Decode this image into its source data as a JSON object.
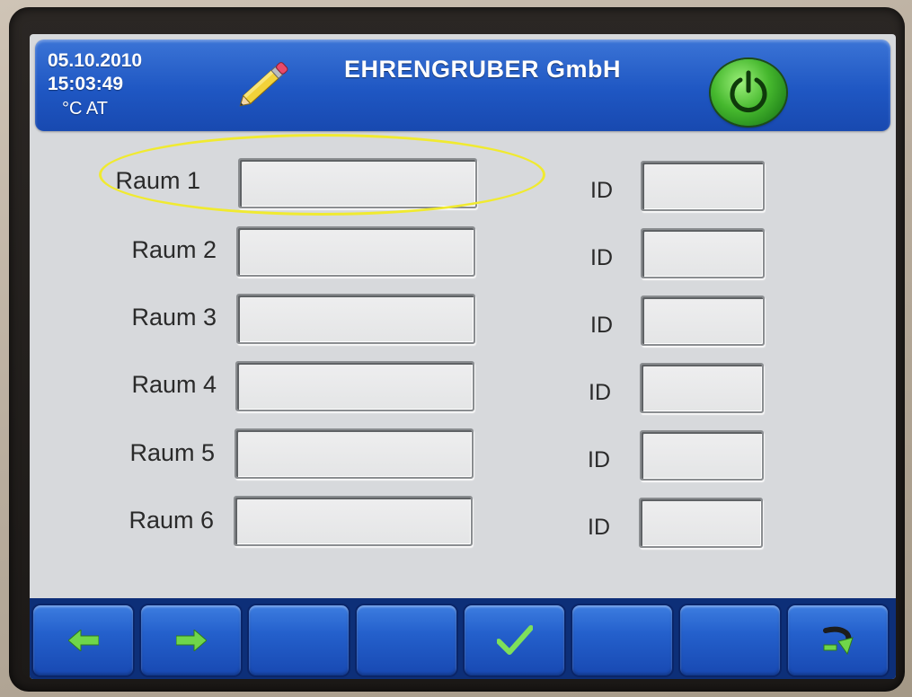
{
  "header": {
    "date": "05.10.2010",
    "time": "15:03:49",
    "unit_country": "°C AT",
    "company": "EHRENGRUBER GmbH",
    "edit_icon": "pencil-icon",
    "power_icon": "power-icon",
    "colors": {
      "accent": "#1f57c3",
      "power": "#46b82e"
    }
  },
  "rooms": [
    {
      "label": "Raum 1",
      "name_value": "",
      "id_label": "ID",
      "id_value": ""
    },
    {
      "label": "Raum 2",
      "name_value": "",
      "id_label": "ID",
      "id_value": ""
    },
    {
      "label": "Raum 3",
      "name_value": "",
      "id_label": "ID",
      "id_value": ""
    },
    {
      "label": "Raum 4",
      "name_value": "",
      "id_label": "ID",
      "id_value": ""
    },
    {
      "label": "Raum 5",
      "name_value": "",
      "id_label": "ID",
      "id_value": ""
    },
    {
      "label": "Raum 6",
      "name_value": "",
      "id_label": "ID",
      "id_value": ""
    }
  ],
  "toolbar": {
    "buttons": [
      {
        "icon": "arrow-left-icon"
      },
      {
        "icon": "arrow-right-icon"
      },
      {
        "icon": ""
      },
      {
        "icon": ""
      },
      {
        "icon": "checkmark-icon"
      },
      {
        "icon": ""
      },
      {
        "icon": ""
      },
      {
        "icon": "return-icon"
      }
    ]
  }
}
